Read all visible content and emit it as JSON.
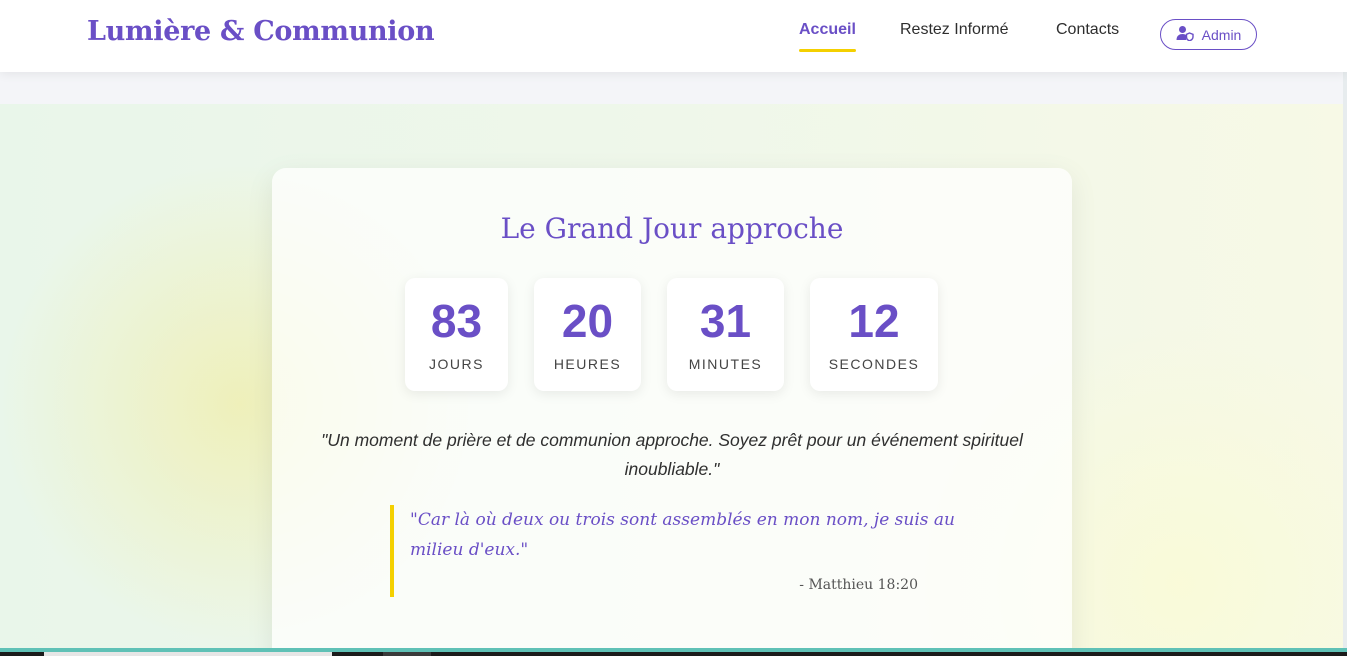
{
  "brand": "Lumière & Communion",
  "nav": {
    "links": [
      {
        "label": "Accueil",
        "active": true
      },
      {
        "label": "Restez Informé",
        "active": false
      },
      {
        "label": "Contacts",
        "active": false
      }
    ],
    "admin_label": "Admin"
  },
  "countdown": {
    "title": "Le Grand Jour approche",
    "units": [
      {
        "value": "83",
        "label": "JOURS"
      },
      {
        "value": "20",
        "label": "HEURES"
      },
      {
        "value": "31",
        "label": "MINUTES"
      },
      {
        "value": "12",
        "label": "SECONDES"
      }
    ],
    "intro": "\"Un moment de prière et de communion approche. Soyez prêt pour un événement spirituel inoubliable.\"",
    "verse": "\"Car là où deux ou trois sont assemblés en mon nom, je suis au milieu d'eux.\"",
    "verse_ref": "- Matthieu 18:20"
  },
  "colors": {
    "accent": "#6a4fc6",
    "highlight": "#f4d000"
  }
}
